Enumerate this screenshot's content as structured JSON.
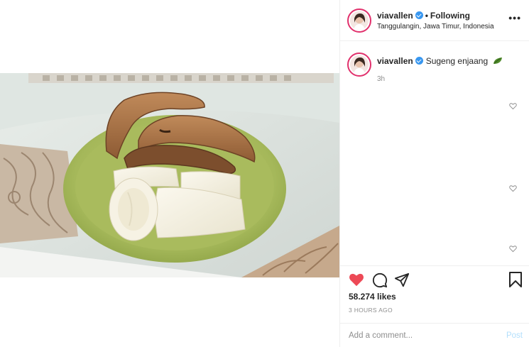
{
  "post": {
    "username": "viavallen",
    "follow_status": "Following",
    "location": "Tanggulangin, Jawa Timur, Indonesia",
    "more_label": "•••",
    "caption": "Sugeng enjaang",
    "caption_time": "3h",
    "likes": "58.274 likes",
    "posted_ago": "3 HOURS AGO",
    "comment_placeholder": "Add a comment...",
    "post_label": "Post"
  },
  "colors": {
    "verified": "#3897f0",
    "like_red": "#ed4956",
    "story_ring": "#e1306c",
    "post_disabled": "#b2dffc"
  },
  "icons": [
    "verified-badge-icon",
    "more-options-icon",
    "leaf-emoji-icon",
    "heart-icon",
    "comment-icon",
    "share-icon",
    "bookmark-icon"
  ]
}
